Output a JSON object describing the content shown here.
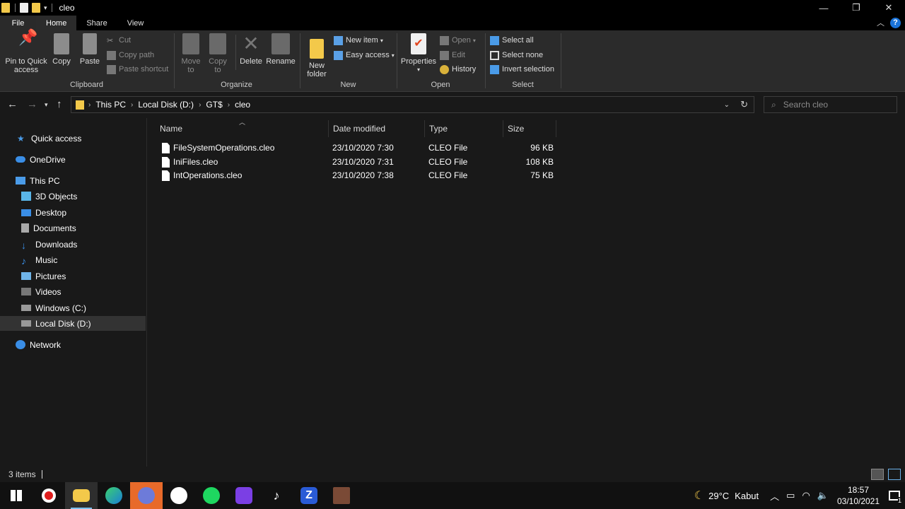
{
  "window": {
    "title": "cleo"
  },
  "tabs": [
    {
      "label": "File"
    },
    {
      "label": "Home"
    },
    {
      "label": "Share"
    },
    {
      "label": "View"
    }
  ],
  "ribbon": {
    "clipboard": {
      "label": "Clipboard",
      "pin": "Pin to Quick access",
      "copy": "Copy",
      "paste": "Paste",
      "cut": "Cut",
      "copy_path": "Copy path",
      "paste_shortcut": "Paste shortcut"
    },
    "organize": {
      "label": "Organize",
      "move_to": "Move to",
      "copy_to": "Copy to",
      "delete": "Delete",
      "rename": "Rename"
    },
    "new": {
      "label": "New",
      "new_folder": "New folder",
      "new_item": "New item",
      "easy_access": "Easy access"
    },
    "open": {
      "label": "Open",
      "properties": "Properties",
      "open": "Open",
      "edit": "Edit",
      "history": "History"
    },
    "select": {
      "label": "Select",
      "select_all": "Select all",
      "select_none": "Select none",
      "invert": "Invert selection"
    }
  },
  "address": {
    "crumbs": [
      "This PC",
      "Local Disk (D:)",
      "GT$",
      "cleo"
    ],
    "search_placeholder": "Search cleo"
  },
  "nav": {
    "quick_access": "Quick access",
    "onedrive": "OneDrive",
    "this_pc": "This PC",
    "objects3d": "3D Objects",
    "desktop": "Desktop",
    "documents": "Documents",
    "downloads": "Downloads",
    "music": "Music",
    "pictures": "Pictures",
    "videos": "Videos",
    "windows_c": "Windows  (C:)",
    "local_d": "Local Disk (D:)",
    "network": "Network"
  },
  "columns": {
    "name": "Name",
    "date": "Date modified",
    "type": "Type",
    "size": "Size"
  },
  "files": [
    {
      "name": "FileSystemOperations.cleo",
      "date": "23/10/2020 7:30",
      "type": "CLEO File",
      "size": "96 KB"
    },
    {
      "name": "IniFiles.cleo",
      "date": "23/10/2020 7:31",
      "type": "CLEO File",
      "size": "108 KB"
    },
    {
      "name": "IntOperations.cleo",
      "date": "23/10/2020 7:38",
      "type": "CLEO File",
      "size": "75 KB"
    }
  ],
  "status": {
    "items": "3 items"
  },
  "taskbar": {
    "weather_temp": "29°C",
    "weather_desc": "Kabut",
    "time": "18:57",
    "date": "03/10/2021",
    "notif_count": "1"
  }
}
